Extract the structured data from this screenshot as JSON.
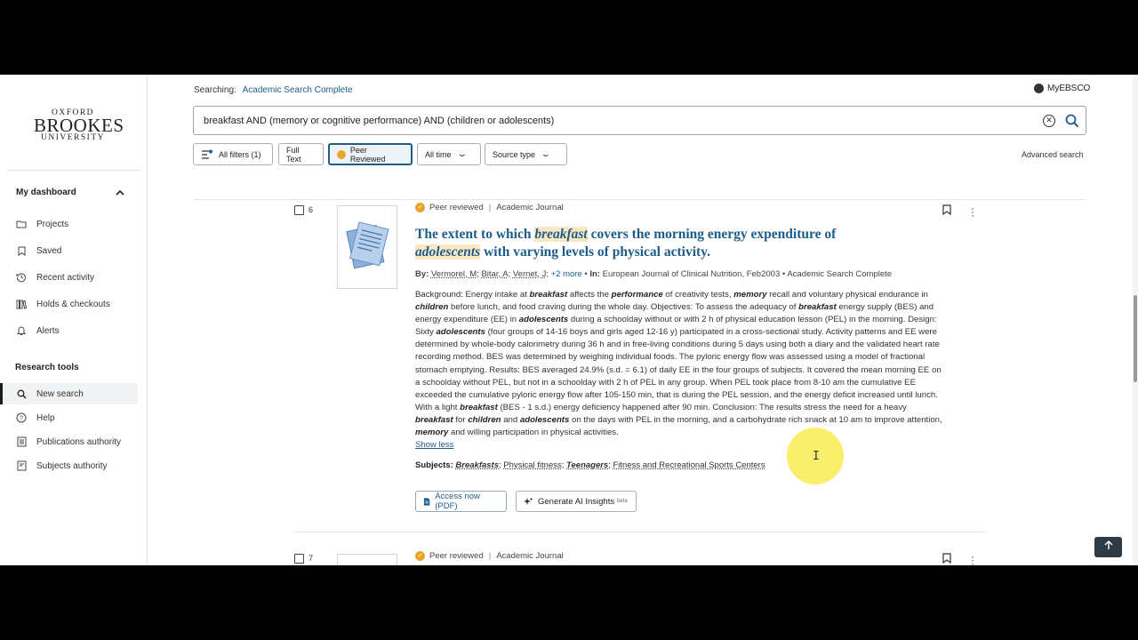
{
  "sidebar": {
    "logo": {
      "line1": "OXFORD",
      "line2": "BROOKES",
      "line3": "UNIVERSITY"
    },
    "dashboard_heading": "My dashboard",
    "dashboard_items": [
      {
        "label": "Projects",
        "icon": "folder-icon"
      },
      {
        "label": "Saved",
        "icon": "bookmark-icon"
      },
      {
        "label": "Recent activity",
        "icon": "history-icon"
      },
      {
        "label": "Holds & checkouts",
        "icon": "books-icon"
      },
      {
        "label": "Alerts",
        "icon": "bell-icon"
      }
    ],
    "tools_heading": "Research tools",
    "tools_items": [
      {
        "label": "New search",
        "icon": "search-icon",
        "active": true
      },
      {
        "label": "Help",
        "icon": "help-icon"
      },
      {
        "label": "Publications authority",
        "icon": "publications-icon"
      },
      {
        "label": "Subjects authority",
        "icon": "subjects-icon"
      }
    ]
  },
  "header": {
    "searching_label": "Searching:",
    "database": "Academic Search Complete",
    "account": "MyEBSCO",
    "query": "breakfast AND (memory or cognitive performance) AND (children or adolescents)",
    "advanced": "Advanced search"
  },
  "filters": {
    "all_filters": "All filters (1)",
    "full_text": "Full Text",
    "peer_reviewed": "Peer Reviewed",
    "time": "All time",
    "source_type": "Source type"
  },
  "result": {
    "number": "6",
    "peer_label": "Peer reviewed",
    "source_label": "Academic Journal",
    "title_parts": [
      "The extent to which ",
      "breakfast",
      " covers the morning energy expenditure of ",
      "adolescents",
      " with varying levels of physical activity."
    ],
    "by_label": "By:",
    "authors": [
      "Vermorel, M",
      "Bitar, A",
      "Vernet, J"
    ],
    "more_authors": "+2 more",
    "in_label": "In:",
    "journal": "European Journal of Clinical Nutrition, Feb2003",
    "db": "Academic Search Complete",
    "abstract": "Background: Energy intake at breakfast affects the performance of creativity tests, memory recall and voluntary physical endurance in children before lunch, and food craving during the whole day. Objectives: To assess the adequacy of breakfast energy supply (BES) and energy expenditure (EE) in adolescents during a schoolday without or with 2 h of physical education lesson (PEL) in the morning. Design: Sixty adolescents (four groups of 14-16 boys and girls aged 12-16 y) participated in a cross-sectional study. Activity patterns and EE were determined by whole-body calorimetry during 36 h and in free-living conditions during 5 days using both a diary and the validated heart rate recording method. BES was determined by weighing individual foods. The pyloric energy flow was assessed using a model of fractional stomach emptying. Results: BES averaged 24.9% (s.d. = 6.1) of daily EE in the four groups of subjects. It covered the mean morning EE on a schoolday without PEL, but not in a schoolday with 2 h of PEL in any group. When PEL took place from 8-10 am the cumulative EE exceeded the cumulative pyloric energy flow after 105-150 min, that is during the PEL session, and the energy deficit increased until lunch. With a light breakfast (BES - 1 s.d.) energy deficiency happened after 90 min. Conclusion: The results stress the need for a heavy breakfast for children and adolescents on the days with PEL in the morning, and a carbohydrate rich snack at 10 am to improve attention, memory and willing participation in physical activities.",
    "highlight_terms": [
      "breakfast",
      "performance",
      "memory",
      "children",
      "adolescents"
    ],
    "show_less": "Show less",
    "subjects_label": "Subjects:",
    "subjects": [
      {
        "label": "Breakfasts",
        "em": true
      },
      {
        "label": "Physical fitness",
        "em": false
      },
      {
        "label": "Teenagers",
        "em": true
      },
      {
        "label": "Fitness and Recreational Sports Centers",
        "em": false
      }
    ],
    "access_pdf": "Access now (PDF)",
    "ai_insights": "Generate AI Insights",
    "ai_beta": "beta"
  },
  "next_result": {
    "number": "7",
    "peer_label": "Peer reviewed",
    "source_label": "Academic Journal"
  },
  "colors": {
    "link": "#1d5d8a",
    "highlight": "#fbe7c2",
    "badge": "#e9a42c"
  }
}
